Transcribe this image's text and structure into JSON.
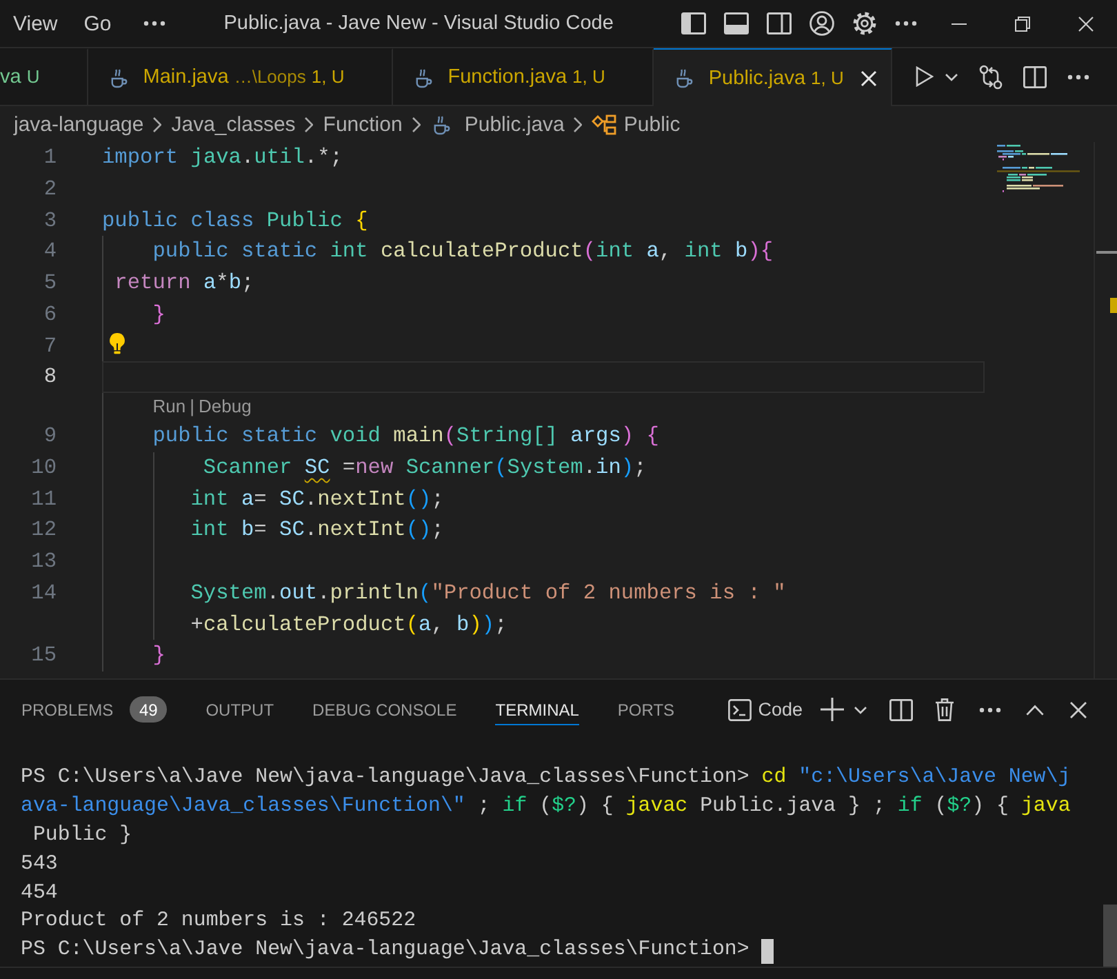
{
  "title_bar": {
    "menu": [
      "View",
      "Go"
    ],
    "title": "Public.java - Jave New - Visual Studio Code"
  },
  "tabs": [
    {
      "label": "va",
      "decoration": "U",
      "kind": "clipped",
      "color": "#73c991",
      "selected": false
    },
    {
      "label": "Main.java",
      "description": "…\\Loops",
      "decoration": "1, U",
      "kind": "file",
      "color": "#cca700",
      "selected": false
    },
    {
      "label": "Function.java",
      "decoration": "1, U",
      "kind": "file",
      "color": "#cca700",
      "selected": false
    },
    {
      "label": "Public.java",
      "decoration": "1, U",
      "kind": "file",
      "color": "#cca700",
      "selected": true
    }
  ],
  "breadcrumb": [
    {
      "label": "java-language",
      "kind": "folder"
    },
    {
      "label": "Java_classes",
      "kind": "folder"
    },
    {
      "label": "Function",
      "kind": "folder"
    },
    {
      "label": "Public.java",
      "kind": "file"
    },
    {
      "label": "Public",
      "kind": "class"
    }
  ],
  "editor": {
    "lines": [
      {
        "number": "1",
        "current": false,
        "lightbulb": false,
        "tokens": [
          {
            "text": "import ",
            "kind": "keyword"
          },
          {
            "text": "java",
            "kind": "type"
          },
          {
            "text": ".",
            "kind": "plain"
          },
          {
            "text": "util",
            "kind": "type"
          },
          {
            "text": ".*;",
            "kind": "plain"
          }
        ]
      },
      {
        "number": "2",
        "current": false,
        "lightbulb": false
      },
      {
        "number": "3",
        "current": false,
        "lightbulb": false,
        "tokens": [
          {
            "text": "public class ",
            "kind": "keyword"
          },
          {
            "text": "Public ",
            "kind": "type"
          },
          {
            "text": "{",
            "kind": "bracket1"
          }
        ]
      },
      {
        "number": "4",
        "current": false,
        "lightbulb": false,
        "tokens": [
          {
            "text": "    public static ",
            "kind": "keyword"
          },
          {
            "text": "int ",
            "kind": "type"
          },
          {
            "text": "calculateProduct",
            "kind": "function"
          },
          {
            "text": "(",
            "kind": "bracket2"
          },
          {
            "text": "int ",
            "kind": "type"
          },
          {
            "text": "a",
            "kind": "variable"
          },
          {
            "text": ", ",
            "kind": "plain"
          },
          {
            "text": "int ",
            "kind": "type"
          },
          {
            "text": "b",
            "kind": "variable"
          },
          {
            "text": "){",
            "kind": "bracket2"
          }
        ]
      },
      {
        "number": "5",
        "current": false,
        "lightbulb": false,
        "tokens": [
          {
            "text": " return ",
            "kind": "control"
          },
          {
            "text": "a",
            "kind": "variable"
          },
          {
            "text": "*",
            "kind": "plain"
          },
          {
            "text": "b",
            "kind": "variable"
          },
          {
            "text": ";",
            "kind": "plain"
          }
        ]
      },
      {
        "number": "6",
        "current": false,
        "lightbulb": false,
        "tokens": [
          {
            "text": "    }",
            "kind": "bracket2"
          }
        ]
      },
      {
        "number": "7",
        "current": false,
        "lightbulb": true
      },
      {
        "number": "8",
        "current": true,
        "lightbulb": false
      },
      {
        "number": "9",
        "current": false,
        "lightbulb": false,
        "codelens": {
          "actions": [
            "Run",
            "Debug"
          ],
          "separator": "|"
        },
        "tokens": [
          {
            "text": "    public static ",
            "kind": "keyword"
          },
          {
            "text": "void ",
            "kind": "type"
          },
          {
            "text": "main",
            "kind": "function"
          },
          {
            "text": "(",
            "kind": "bracket2"
          },
          {
            "text": "String[] ",
            "kind": "type"
          },
          {
            "text": "args",
            "kind": "variable"
          },
          {
            "text": ") {",
            "kind": "bracket2"
          }
        ]
      },
      {
        "number": "10",
        "current": false,
        "lightbulb": false,
        "tokens": [
          {
            "text": "        Scanner ",
            "kind": "type"
          },
          {
            "text": "SC",
            "kind": "warned"
          },
          {
            "text": " =",
            "kind": "plain"
          },
          {
            "text": "new ",
            "kind": "control"
          },
          {
            "text": "Scanner",
            "kind": "type"
          },
          {
            "text": "(",
            "kind": "bracket3"
          },
          {
            "text": "System",
            "kind": "type"
          },
          {
            "text": ".",
            "kind": "plain"
          },
          {
            "text": "in",
            "kind": "variable"
          },
          {
            "text": ")",
            "kind": "bracket3"
          },
          {
            "text": ";",
            "kind": "plain"
          }
        ]
      },
      {
        "number": "11",
        "current": false,
        "lightbulb": false,
        "tokens": [
          {
            "text": "       int ",
            "kind": "type"
          },
          {
            "text": "a",
            "kind": "variable"
          },
          {
            "text": "= ",
            "kind": "plain"
          },
          {
            "text": "SC",
            "kind": "variable"
          },
          {
            "text": ".",
            "kind": "plain"
          },
          {
            "text": "nextInt",
            "kind": "function"
          },
          {
            "text": "()",
            "kind": "bracket3"
          },
          {
            "text": ";",
            "kind": "plain"
          }
        ]
      },
      {
        "number": "12",
        "current": false,
        "lightbulb": false,
        "tokens": [
          {
            "text": "       int ",
            "kind": "type"
          },
          {
            "text": "b",
            "kind": "variable"
          },
          {
            "text": "= ",
            "kind": "plain"
          },
          {
            "text": "SC",
            "kind": "variable"
          },
          {
            "text": ".",
            "kind": "plain"
          },
          {
            "text": "nextInt",
            "kind": "function"
          },
          {
            "text": "()",
            "kind": "bracket3"
          },
          {
            "text": ";",
            "kind": "plain"
          }
        ]
      },
      {
        "number": "13",
        "current": false,
        "lightbulb": false
      },
      {
        "number": "14",
        "current": false,
        "lightbulb": false,
        "tokens": [
          {
            "text": "       System",
            "kind": "type"
          },
          {
            "text": ".",
            "kind": "plain"
          },
          {
            "text": "out",
            "kind": "variable"
          },
          {
            "text": ".",
            "kind": "plain"
          },
          {
            "text": "println",
            "kind": "function"
          },
          {
            "text": "(",
            "kind": "bracket3"
          },
          {
            "text": "\"Product of 2 numbers is : \"",
            "kind": "string"
          }
        ],
        "wrap": [
          {
            "text": "       +",
            "kind": "plain"
          },
          {
            "text": "calculateProduct",
            "kind": "function"
          },
          {
            "text": "(",
            "kind": "bracket1"
          },
          {
            "text": "a",
            "kind": "variable"
          },
          {
            "text": ", ",
            "kind": "plain"
          },
          {
            "text": "b",
            "kind": "variable"
          },
          {
            "text": ")",
            "kind": "bracket1"
          },
          {
            "text": ")",
            "kind": "bracket3"
          },
          {
            "text": ";",
            "kind": "plain"
          }
        ]
      },
      {
        "number": "15",
        "current": false,
        "lightbulb": false,
        "tokens": [
          {
            "text": "    }",
            "kind": "bracket2"
          }
        ]
      }
    ]
  },
  "panel": {
    "tabs": [
      {
        "label": "PROBLEMS",
        "badge": "49",
        "selected": false
      },
      {
        "label": "OUTPUT",
        "selected": false
      },
      {
        "label": "DEBUG CONSOLE",
        "selected": false
      },
      {
        "label": "TERMINAL",
        "selected": true
      },
      {
        "label": "PORTS",
        "selected": false
      }
    ],
    "terminal_name": "Code",
    "terminal": {
      "rows": [
        {
          "cursor": false,
          "tokens": [
            {
              "text": "PS C:\\Users\\a\\Jave New\\java-language\\Java_classes\\Function> ",
              "kind": "plain"
            },
            {
              "text": "cd ",
              "kind": "command"
            },
            {
              "text": "\"c:\\Users\\a\\Jave New\\j",
              "kind": "string"
            }
          ]
        },
        {
          "cursor": false,
          "tokens": [
            {
              "text": "ava-language\\Java_classes\\Function\\\"",
              "kind": "string"
            },
            {
              "text": " ; ",
              "kind": "plain"
            },
            {
              "text": "if ",
              "kind": "keyword"
            },
            {
              "text": "(",
              "kind": "plain"
            },
            {
              "text": "$?",
              "kind": "keyword"
            },
            {
              "text": ") { ",
              "kind": "plain"
            },
            {
              "text": "javac ",
              "kind": "command"
            },
            {
              "text": "Public.java } ; ",
              "kind": "plain"
            },
            {
              "text": "if ",
              "kind": "keyword"
            },
            {
              "text": "(",
              "kind": "plain"
            },
            {
              "text": "$?",
              "kind": "keyword"
            },
            {
              "text": ") { ",
              "kind": "plain"
            },
            {
              "text": "java",
              "kind": "command"
            }
          ]
        },
        {
          "cursor": false,
          "tokens": [
            {
              "text": " Public }",
              "kind": "plain"
            }
          ]
        },
        {
          "cursor": false,
          "tokens": [
            {
              "text": "543",
              "kind": "plain"
            }
          ]
        },
        {
          "cursor": false,
          "tokens": [
            {
              "text": "454",
              "kind": "plain"
            }
          ]
        },
        {
          "cursor": false,
          "tokens": [
            {
              "text": "Product of 2 numbers is : 246522",
              "kind": "plain"
            }
          ]
        },
        {
          "cursor": true,
          "tokens": [
            {
              "text": "PS C:\\Users\\a\\Jave New\\java-language\\Java_classes\\Function> ",
              "kind": "plain"
            }
          ]
        }
      ]
    }
  }
}
